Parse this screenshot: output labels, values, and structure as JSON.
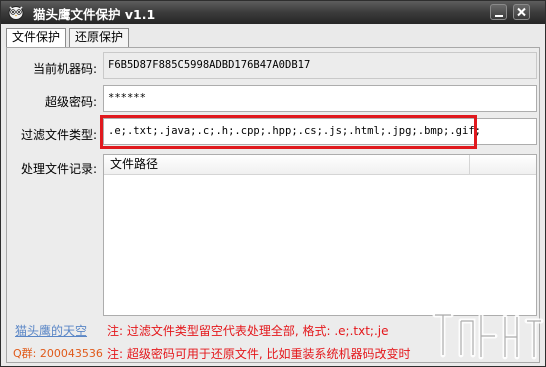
{
  "window": {
    "title": "猫头鹰文件保护 v1.1"
  },
  "tabs": [
    {
      "label": "文件保护",
      "active": true
    },
    {
      "label": "还原保护",
      "active": false
    }
  ],
  "form": {
    "machine_label": "当前机器码:",
    "machine_value": "F6B5D87F885C5998ADBD176B47A0DB17",
    "password_label": "超级密码:",
    "password_value": "******",
    "filter_label": "过滤文件类型:",
    "filter_value": ".e;.txt;.java;.c;.h;.cpp;.hpp;.cs;.js;.html;.jpg;.bmp;.gif;",
    "records_label": "处理文件记录:"
  },
  "records": {
    "columns": [
      "文件路径"
    ]
  },
  "footer": {
    "site_link": "猫头鹰的天空",
    "qq": "Q群: 200043536",
    "note_1": "注: 过滤文件类型留空代表处理全部, 格式: .e;.txt;.je",
    "note_2": "注: 超级密码可用于还原文件, 比如重装系统机器码改变时"
  },
  "colors": {
    "highlight": "#e0191e",
    "link": "#5a86c6",
    "note": "#e4171b",
    "qq": "#e05a1a"
  },
  "icons": {
    "app": "owl-icon",
    "minimize": "minimize-icon",
    "close": "close-icon",
    "watermark": "watermark-logo"
  }
}
